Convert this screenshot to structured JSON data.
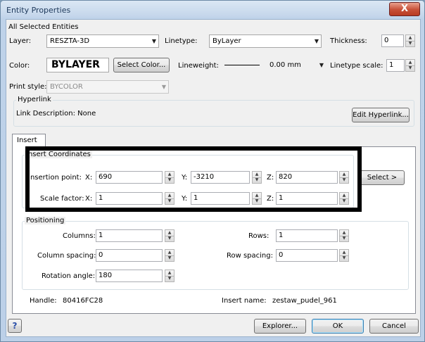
{
  "window": {
    "title": "Entity Properties",
    "close_glyph": "X"
  },
  "top_group": {
    "title": "All Selected Entities",
    "layer_label": "Layer:",
    "layer_value": "RESZTA-3D",
    "linetype_label": "Linetype:",
    "linetype_value": "ByLayer",
    "thickness_label": "Thickness:",
    "thickness_value": "0",
    "color_label": "Color:",
    "color_value": "BYLAYER",
    "select_color_button": "Select Color...",
    "lineweight_label": "Lineweight:",
    "lineweight_value": "0.00 mm",
    "linetype_scale_label": "Linetype scale:",
    "linetype_scale_value": "1",
    "print_style_label": "Print style:",
    "print_style_value": "BYCOLOR",
    "hyperlink_title": "Hyperlink",
    "link_description": "Link Description: None",
    "edit_hyperlink_button": "Edit Hyperlink..."
  },
  "tabs": [
    {
      "label": "Insert"
    }
  ],
  "insert_coordinates": {
    "title": "Insert Coordinates",
    "insertion_point_label": "Insertion point:",
    "scale_factor_label": "Scale factor:",
    "x_label": "X:",
    "y_label": "Y:",
    "z_label": "Z:",
    "insertion": {
      "x": "690",
      "y": "-3210",
      "z": "820"
    },
    "scale": {
      "x": "1",
      "y": "1",
      "z": "1"
    },
    "select_button": "Select >"
  },
  "positioning": {
    "title": "Positioning",
    "columns_label": "Columns:",
    "columns_value": "1",
    "rows_label": "Rows:",
    "rows_value": "1",
    "column_spacing_label": "Column spacing:",
    "column_spacing_value": "0",
    "row_spacing_label": "Row spacing:",
    "row_spacing_value": "0",
    "rotation_angle_label": "Rotation angle:",
    "rotation_angle_value": "180"
  },
  "info": {
    "handle_label": "Handle:",
    "handle_value": "80416FC28",
    "insert_name_label": "Insert name:",
    "insert_name_value": "zestaw_pudel_961"
  },
  "footer": {
    "help_glyph": "?",
    "explorer_button": "Explorer...",
    "ok_button": "OK",
    "cancel_button": "Cancel"
  },
  "icons": {
    "dropdown": "▼",
    "spin_up": "▲",
    "spin_down": "▼"
  }
}
